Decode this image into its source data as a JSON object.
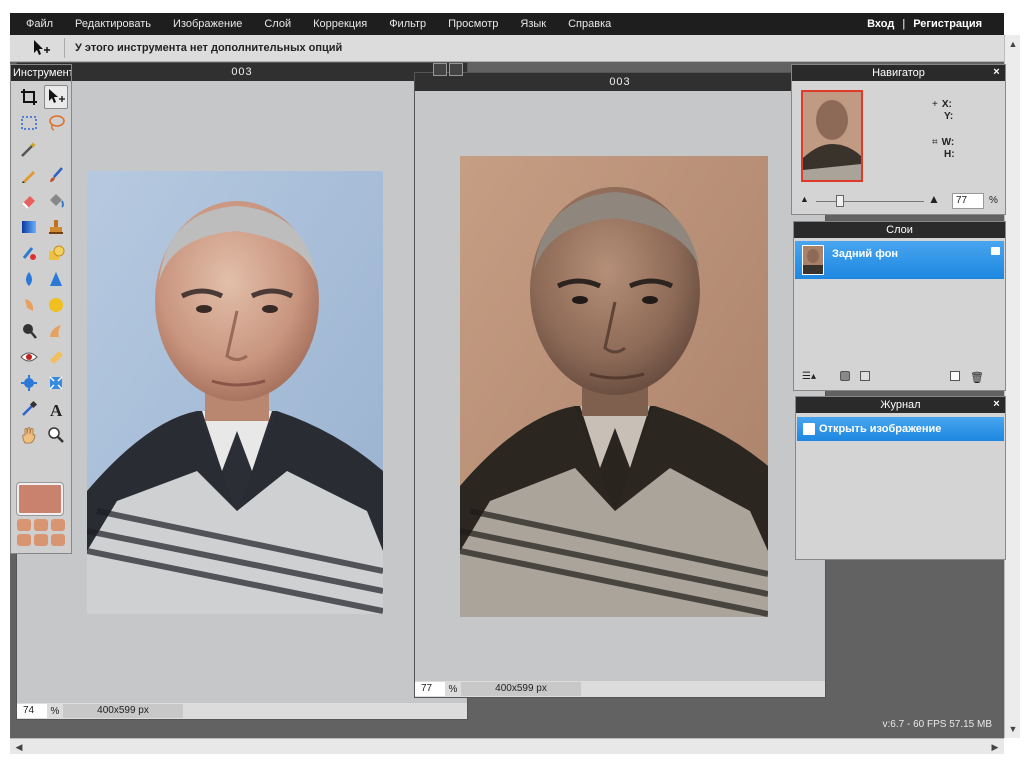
{
  "menu": {
    "items": [
      "Файл",
      "Редактировать",
      "Изображение",
      "Слой",
      "Коррекция",
      "Фильтр",
      "Просмотр",
      "Язык",
      "Справка"
    ],
    "login": "Вход",
    "separator": "|",
    "register": "Регистрация"
  },
  "options": {
    "tool_icon": "move-icon",
    "text": "У этого инструмента нет дополнительных опций"
  },
  "toolbox": {
    "title": "Инструмент",
    "tools": [
      "crop-icon",
      "move-icon",
      "marquee-icon",
      "lasso-icon",
      "wand-icon",
      "",
      "pencil-icon",
      "brush-icon",
      "eraser-icon",
      "bucket-icon",
      "gradient-icon",
      "stamp-icon",
      "colorreplace-icon",
      "shape-icon",
      "blur-icon",
      "sharpen-icon",
      "smudge-icon",
      "sponge-icon",
      "dodge-icon",
      "burn-icon",
      "redeye-icon",
      "spotheal-icon",
      "bloat-icon",
      "pinch-icon",
      "picker-icon",
      "type-icon",
      "hand-icon",
      "zoom-icon"
    ],
    "foreground_color": "#c8826e"
  },
  "doc_left": {
    "title": "003",
    "zoom": "74",
    "pct": "%",
    "size": "400x599 px"
  },
  "doc_right": {
    "title": "003",
    "zoom": "77",
    "pct": "%",
    "size": "400x599 px"
  },
  "navigator": {
    "title": "Навигатор",
    "x_label": "X:",
    "y_label": "Y:",
    "w_label": "W:",
    "h_label": "H:",
    "zoom_value": "77",
    "pct": "%"
  },
  "layers": {
    "title": "Слои",
    "items": [
      {
        "name": "Задний фон",
        "locked": true
      }
    ]
  },
  "history": {
    "title": "Журнал",
    "items": [
      "Открыть изображение"
    ]
  },
  "status": {
    "version": "v:6.7 - 60 FPS 57.15 MB"
  },
  "colors": {
    "selection": "#1d87e0",
    "foreground": "#c8826e",
    "menubar": "#1e1e1e"
  }
}
